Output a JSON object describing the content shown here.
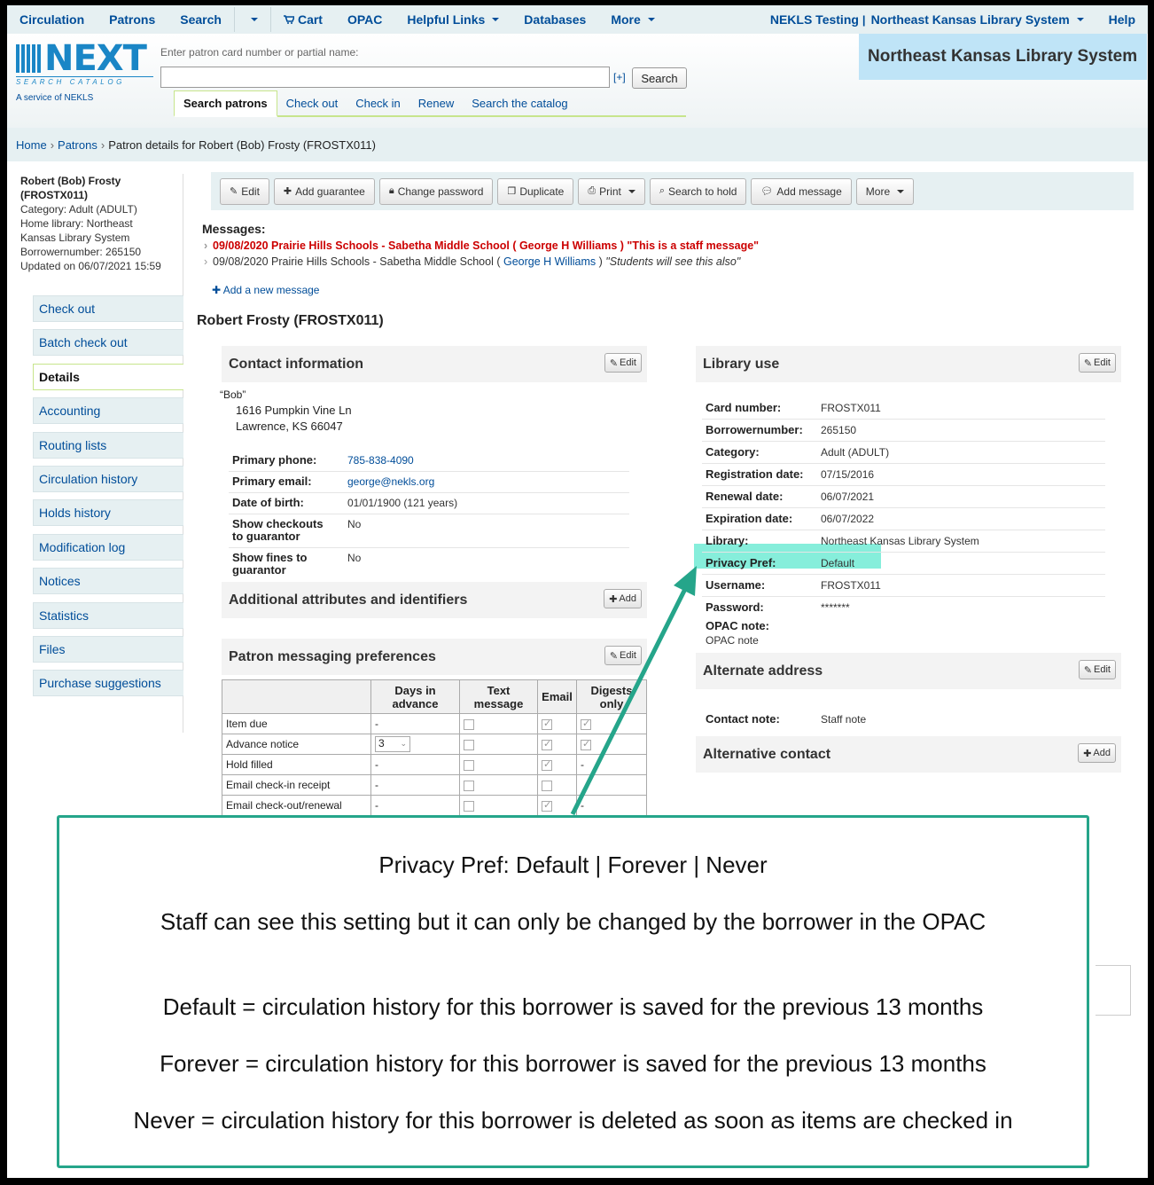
{
  "topnav": {
    "left": [
      "Circulation",
      "Patrons",
      "Search",
      "Cart",
      "OPAC",
      "Helpful Links",
      "Databases",
      "More"
    ],
    "right_library": "NEKLS Testing",
    "right_system": "Northeast Kansas Library System",
    "help": "Help"
  },
  "header": {
    "logo_word": "NEXT",
    "logo_sub": "SEARCH CATALOG",
    "logo_service": "A service of NEKLS",
    "patron_label": "Enter patron card number or partial name:",
    "plus": "[+]",
    "search_button": "Search",
    "tabs": [
      "Search patrons",
      "Check out",
      "Check in",
      "Renew",
      "Search the catalog"
    ],
    "library_banner": "Northeast Kansas Library System"
  },
  "breadcrumb": {
    "home": "Home",
    "patrons": "Patrons",
    "current": "Patron details for Robert (Bob) Frosty (FROSTX011)"
  },
  "patron_brief": {
    "name_line1": "Robert (Bob) Frosty",
    "name_line2": "(FROSTX011)",
    "category": "Category: Adult (ADULT)",
    "home_library_1": "Home library: Northeast",
    "home_library_2": "Kansas Library System",
    "borrowernumber": "Borrowernumber: 265150",
    "updated": "Updated on 06/07/2021 15:59"
  },
  "menu": [
    "Check out",
    "Batch check out",
    "Details",
    "Accounting",
    "Routing lists",
    "Circulation history",
    "Holds history",
    "Modification log",
    "Notices",
    "Statistics",
    "Files",
    "Purchase suggestions"
  ],
  "toolbar": [
    "Edit",
    "Add guarantee",
    "Change password",
    "Duplicate",
    "Print",
    "Search to hold",
    "Add message",
    "More"
  ],
  "messages": {
    "heading": "Messages:",
    "staff": "09/08/2020 Prairie Hills Schools - Sabetha Middle School ( George H Williams ) \"This is a staff message\"",
    "opac_prefix": "09/08/2020 Prairie Hills Schools - Sabetha Middle School (",
    "opac_author": "George H Williams",
    "opac_suffix": ")",
    "opac_text": "\"Students will see this also\"",
    "add_new": "Add a new message"
  },
  "patron_title": "Robert Frosty (FROSTX011)",
  "contact": {
    "heading": "Contact information",
    "edit": "Edit",
    "nickname": "“Bob”",
    "address1": "1616 Pumpkin Vine Ln",
    "address2": "Lawrence, KS 66047",
    "rows": [
      {
        "k": "Primary phone:",
        "v": "785-838-4090"
      },
      {
        "k": "Primary email:",
        "v": "george@nekls.org"
      },
      {
        "k": "Date of birth:",
        "v": "01/01/1900 (121 years)"
      },
      {
        "k": "Show checkouts to guarantor",
        "v": "No"
      },
      {
        "k": "Show fines to guarantor",
        "v": "No"
      }
    ]
  },
  "attributes": {
    "heading": "Additional attributes and identifiers",
    "add": "Add"
  },
  "messaging": {
    "heading": "Patron messaging preferences",
    "edit": "Edit",
    "columns": [
      "",
      "Days in advance",
      "Text message",
      "Email",
      "Digests only"
    ],
    "rows": [
      "Item due",
      "Advance notice",
      "Hold filled",
      "Email check-in receipt",
      "Email check-out/renewal"
    ],
    "advance_days": "3",
    "dash": "-"
  },
  "library_use": {
    "heading": "Library use",
    "edit": "Edit",
    "rows": [
      {
        "k": "Card number:",
        "v": "FROSTX011"
      },
      {
        "k": "Borrowernumber:",
        "v": "265150"
      },
      {
        "k": "Category:",
        "v": "Adult (ADULT)"
      },
      {
        "k": "Registration date:",
        "v": "07/15/2016"
      },
      {
        "k": "Renewal date:",
        "v": "06/07/2021"
      },
      {
        "k": "Expiration date:",
        "v": "06/07/2022"
      },
      {
        "k": "Library:",
        "v": "Northeast Kansas Library System"
      },
      {
        "k": "Privacy Pref:",
        "v": "Default"
      },
      {
        "k": "Username:",
        "v": "FROSTX011"
      },
      {
        "k": "Password:",
        "v": "*******"
      }
    ],
    "opac_note_label": "OPAC note:",
    "opac_note_value": "OPAC note"
  },
  "alternate_address": {
    "heading": "Alternate address",
    "edit": "Edit",
    "contact_note_label": "Contact note:",
    "contact_note_value": "Staff note"
  },
  "alternative_contact": {
    "heading": "Alternative contact",
    "add": "Add"
  },
  "callout": {
    "line1": "Privacy Pref: Default | Forever | Never",
    "line2": "Staff can see this setting but it can only be changed by the borrower in the OPAC",
    "line3": "Default = circulation history for this borrower is saved for the previous 13 months",
    "line4": "Forever = circulation history for this borrower is saved for the previous 13 months",
    "line5": "Never = circulation history for this borrower is deleted as soon as items are checked in"
  },
  "colors": {
    "accent": "#004d99",
    "highlight": "#5ee8cf",
    "callout_border": "#25a58a",
    "staff_message": "#cc0000"
  }
}
